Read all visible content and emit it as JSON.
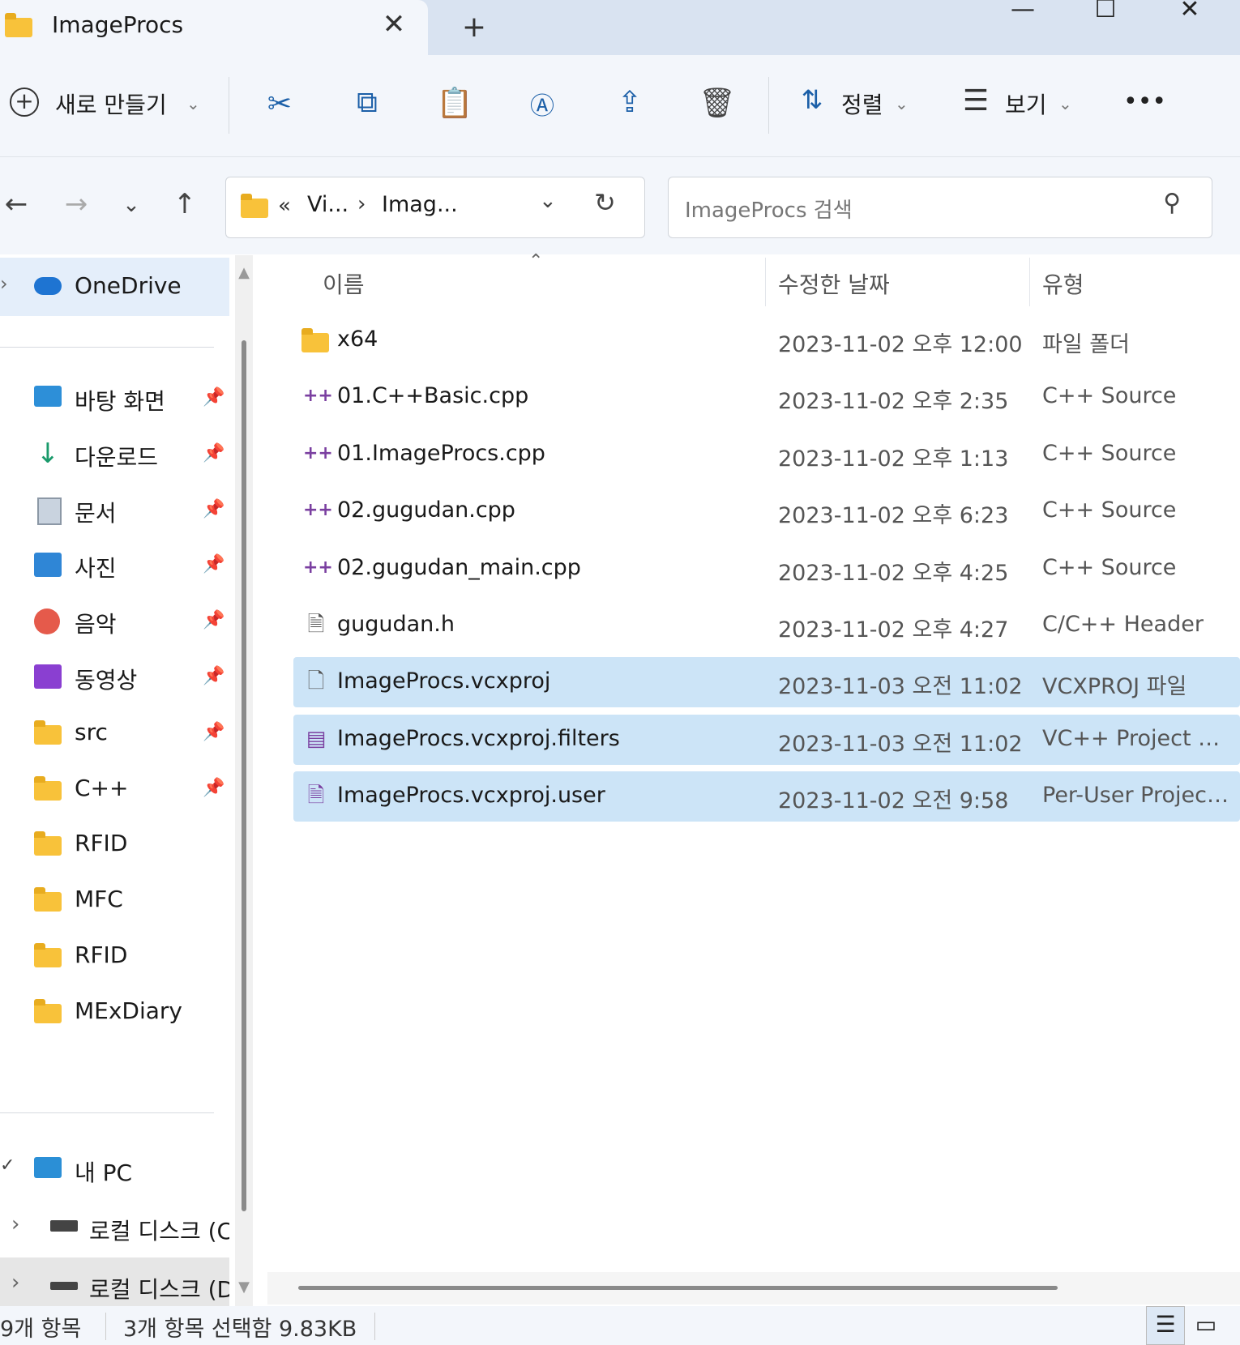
{
  "window": {
    "tab_title": "ImageProcs",
    "tab_close": "✕",
    "new_tab": "+",
    "minimize": "—",
    "maximize": "☐",
    "close": "✕"
  },
  "toolbar": {
    "new_label": "새로 만들기",
    "sort_label": "정렬",
    "view_label": "보기",
    "more": "•••"
  },
  "address": {
    "overflow": "«",
    "crumbs": [
      "Vi...",
      "Imag..."
    ],
    "separator": "›"
  },
  "search": {
    "placeholder": "ImageProcs 검색"
  },
  "sidebar": {
    "onedrive": "OneDrive",
    "quick": [
      {
        "label": "바탕 화면",
        "icon": "desktop-icon",
        "pinned": true
      },
      {
        "label": "다운로드",
        "icon": "download-icon",
        "pinned": true
      },
      {
        "label": "문서",
        "icon": "documents-icon",
        "pinned": true
      },
      {
        "label": "사진",
        "icon": "pictures-icon",
        "pinned": true
      },
      {
        "label": "음악",
        "icon": "music-icon",
        "pinned": true
      },
      {
        "label": "동영상",
        "icon": "videos-icon",
        "pinned": true
      },
      {
        "label": "src",
        "icon": "folder-icon",
        "pinned": true
      },
      {
        "label": "C++",
        "icon": "folder-icon",
        "pinned": true
      },
      {
        "label": "RFID",
        "icon": "folder-icon",
        "pinned": false
      },
      {
        "label": "MFC",
        "icon": "folder-icon",
        "pinned": false
      },
      {
        "label": "RFID",
        "icon": "folder-icon",
        "pinned": false
      },
      {
        "label": "MExDiary",
        "icon": "folder-icon",
        "pinned": false
      }
    ],
    "this_pc": "내 PC",
    "drives": [
      "로컬 디스크 (C",
      "로컬 디스크 (D"
    ]
  },
  "columns": {
    "name": "이름",
    "date": "수정한 날짜",
    "type": "유형"
  },
  "files": [
    {
      "name": "x64",
      "date": "2023-11-02 오후 12:00",
      "type": "파일 폴더",
      "icon": "folder-icon",
      "selected": false
    },
    {
      "name": "01.C++Basic.cpp",
      "date": "2023-11-02 오후 2:35",
      "type": "C++ Source",
      "icon": "cpp-file-icon",
      "selected": false
    },
    {
      "name": "01.ImageProcs.cpp",
      "date": "2023-11-02 오후 1:13",
      "type": "C++ Source",
      "icon": "cpp-file-icon",
      "selected": false
    },
    {
      "name": "02.gugudan.cpp",
      "date": "2023-11-02 오후 6:23",
      "type": "C++ Source",
      "icon": "cpp-file-icon",
      "selected": false
    },
    {
      "name": "02.gugudan_main.cpp",
      "date": "2023-11-02 오후 4:25",
      "type": "C++ Source",
      "icon": "cpp-file-icon",
      "selected": false
    },
    {
      "name": "gugudan.h",
      "date": "2023-11-02 오후 4:27",
      "type": "C/C++ Header",
      "icon": "header-file-icon",
      "selected": false
    },
    {
      "name": "ImageProcs.vcxproj",
      "date": "2023-11-03 오전 11:02",
      "type": "VCXPROJ 파일",
      "icon": "blank-file-icon",
      "selected": true
    },
    {
      "name": "ImageProcs.vcxproj.filters",
      "date": "2023-11-03 오전 11:02",
      "type": "VC++ Project Filt...",
      "icon": "filters-file-icon",
      "selected": true
    },
    {
      "name": "ImageProcs.vcxproj.user",
      "date": "2023-11-02 오전 9:58",
      "type": "Per-User Project ...",
      "icon": "user-file-icon",
      "selected": true
    }
  ],
  "status": {
    "count": "9개 항목",
    "selection": "3개 항목 선택함 9.83KB"
  }
}
